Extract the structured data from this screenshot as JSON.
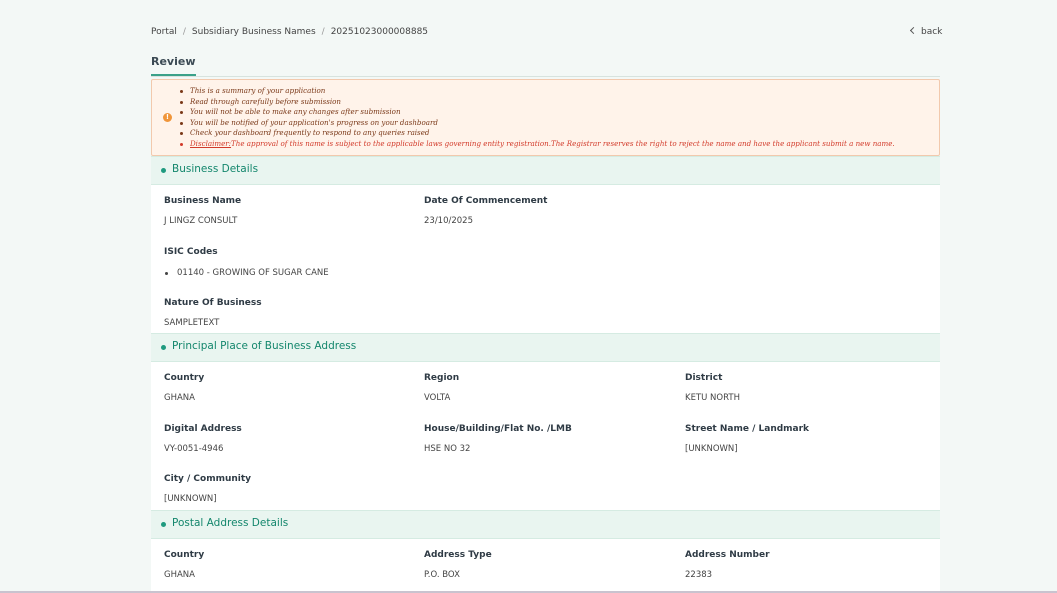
{
  "breadcrumb": [
    "Portal",
    "Subsidiary Business Names",
    "20251023000008885"
  ],
  "back_label": "back",
  "tab_label": "Review",
  "notice": {
    "items": [
      "This is a summary of your application",
      "Read through carefully before submission",
      "You will not be able to make any changes after submission",
      "You will be notified of your application's progress on your dashboard",
      "Check your dashboard frequently to respond to any queries raised"
    ],
    "disclaimer_label": "Disclaimer:",
    "disclaimer_text": "The approval of this name is subject to the applicable laws governing entity registration.The Registrar reserves the right to reject the name and have the applicant submit a new name."
  },
  "business": {
    "title": "Business Details",
    "name_label": "Business Name",
    "name_value": "J LINGZ CONSULT",
    "date_label": "Date Of Commencement",
    "date_value": "23/10/2025",
    "isic_label": "ISIC Codes",
    "isic_items": [
      "01140 - GROWING OF SUGAR CANE"
    ],
    "nature_label": "Nature Of Business",
    "nature_value": "SAMPLETEXT"
  },
  "principal": {
    "title": "Principal Place of Business Address",
    "country_label": "Country",
    "country_value": "GHANA",
    "region_label": "Region",
    "region_value": "VOLTA",
    "district_label": "District",
    "district_value": "KETU NORTH",
    "digital_label": "Digital Address",
    "digital_value": "VY-0051-4946",
    "house_label": "House/Building/Flat No. /LMB",
    "house_value": "HSE NO 32",
    "street_label": "Street Name / Landmark",
    "street_value": "[UNKNOWN]",
    "city_label": "City / Community",
    "city_value": "[UNKNOWN]"
  },
  "postal": {
    "title": "Postal Address Details",
    "country_label": "Country",
    "country_value": "GHANA",
    "type_label": "Address Type",
    "type_value": "P.O. BOX",
    "number_label": "Address Number",
    "number_value": "22383"
  },
  "colors": {
    "accent": "#1f9a7f",
    "notice_bg": "#fff3ea",
    "disclaimer": "#d23a2a"
  }
}
